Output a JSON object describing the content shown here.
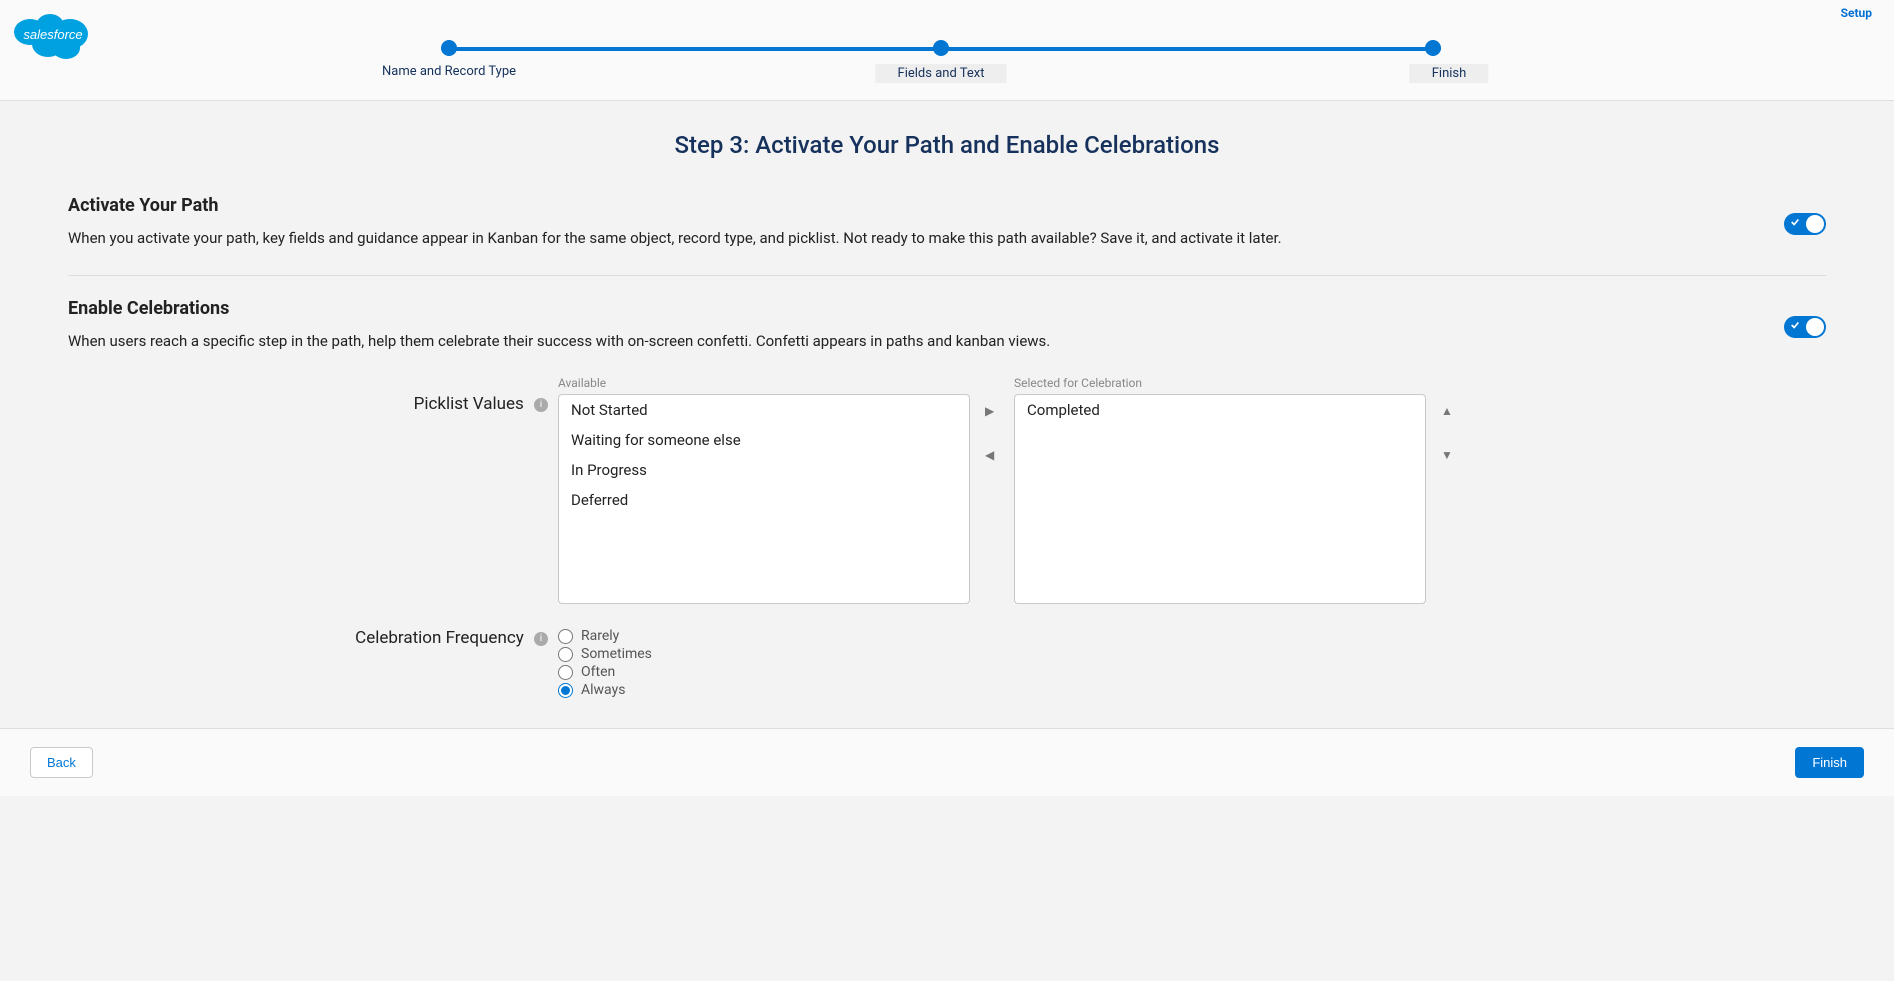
{
  "header": {
    "setup_link": "Setup",
    "logo_text": "salesforce"
  },
  "progress": {
    "steps": [
      "Name and Record Type",
      "Fields and Text",
      "Finish"
    ]
  },
  "page": {
    "title": "Step 3: Activate Your Path and Enable Celebrations"
  },
  "activate": {
    "heading": "Activate Your Path",
    "description": "When you activate your path, key fields and guidance appear in Kanban for the same object, record type, and picklist. Not ready to make this path available? Save it, and activate it later.",
    "enabled": true
  },
  "celebrations": {
    "heading": "Enable Celebrations",
    "description": "When users reach a specific step in the path, help them celebrate their success with on-screen confetti. Confetti appears in paths and kanban views.",
    "enabled": true
  },
  "picklist": {
    "label": "Picklist Values",
    "available_label": "Available",
    "selected_label": "Selected for Celebration",
    "available": [
      "Not Started",
      "Waiting for someone else",
      "In Progress",
      "Deferred"
    ],
    "selected": [
      "Completed"
    ]
  },
  "frequency": {
    "label": "Celebration Frequency",
    "options": [
      "Rarely",
      "Sometimes",
      "Often",
      "Always"
    ],
    "selected": "Always"
  },
  "footer": {
    "back": "Back",
    "finish": "Finish"
  }
}
